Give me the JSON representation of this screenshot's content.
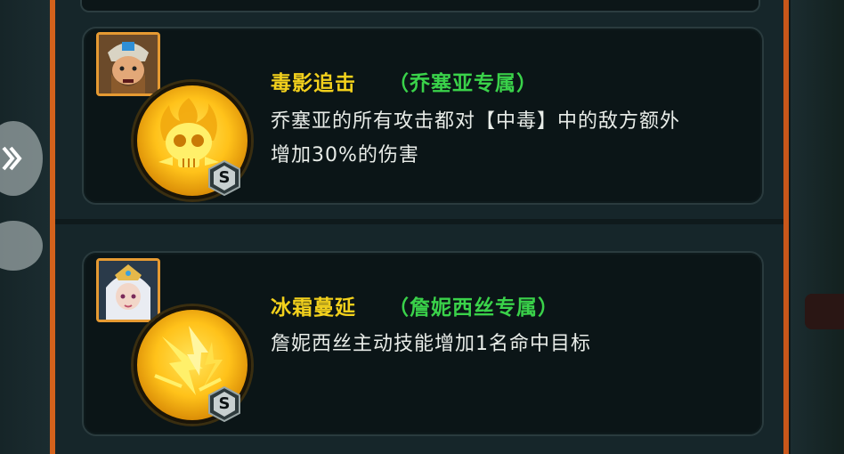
{
  "skills": [
    {
      "name": "毒影追击",
      "tag": "（乔塞亚专属）",
      "description_lines": [
        "乔塞亚的所有攻击都对【中毒】中的敌方额外",
        "增加30%的伤害"
      ],
      "rank": "S",
      "portrait": "josiah-portrait",
      "icon": "poison-skull-icon"
    },
    {
      "name": "冰霜蔓延",
      "tag": "（詹妮西丝专属）",
      "description_lines": [
        "詹妮西丝主动技能增加1名命中目标"
      ],
      "rank": "S",
      "portrait": "jennisis-portrait",
      "icon": "burst-strike-icon"
    }
  ],
  "colors": {
    "title": "#f2d01c",
    "tag": "#3ad24a",
    "description": "#e8ece8",
    "frame": "#d4621c",
    "portrait_border": "#e69a32"
  }
}
